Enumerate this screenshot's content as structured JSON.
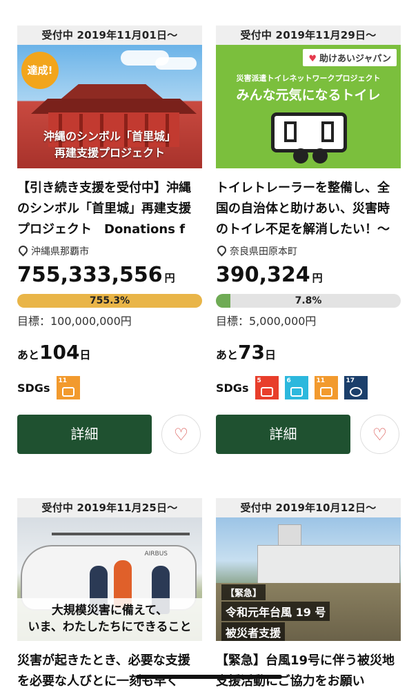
{
  "projects": [
    {
      "date": "受付中 2019年11月01日〜",
      "badge": "達成!",
      "banner_lines": [
        "沖縄のシンボル「首里城」",
        "再建支援プロジェクト"
      ],
      "title": "【引き続き支援を受付中】沖縄のシンボル「首里城」再建支援プロジェクト　Donations f",
      "location": "沖縄県那覇市",
      "amount": "755,333,556",
      "yen": "円",
      "progress_label": "755.3%",
      "progress_fraction": 1.0,
      "goal": "目標：100,000,000円",
      "remain_prefix": "あと",
      "remain_days": "104",
      "remain_suffix": "日",
      "sdgs_label": "SDGs",
      "sdgs": [
        {
          "num": "11",
          "color": "#f29a2e"
        }
      ],
      "detail_label": "詳細"
    },
    {
      "date": "受付中 2019年11月29日〜",
      "banner_tag": "助けあいジャパン",
      "banner_sub": "災害派遣トイレネットワークプロジェクト",
      "banner_main": "みんな元気になるトイレ",
      "title": "トイレトレーラーを整備し、全国の自治体と助けあい、災害時のトイレ不足を解消したい！〜",
      "location": "奈良県田原本町",
      "amount": "390,324",
      "yen": "円",
      "progress_label": "7.8%",
      "progress_fraction": 0.078,
      "goal": "目標：5,000,000円",
      "remain_prefix": "あと",
      "remain_days": "73",
      "remain_suffix": "日",
      "sdgs_label": "SDGs",
      "sdgs": [
        {
          "num": "5",
          "color": "#e83e2b"
        },
        {
          "num": "6",
          "color": "#2cb8dd"
        },
        {
          "num": "11",
          "color": "#f29a2e"
        },
        {
          "num": "17",
          "color": "#1b3f6b"
        }
      ],
      "detail_label": "詳細"
    },
    {
      "date": "受付中 2019年11月25日〜",
      "banner_lines": [
        "大規模災害に備えて、",
        "いま、わたしたちにできること"
      ],
      "heli_brand": "AIRBUS",
      "title": "災害が起きたとき、必要な支援を必要な人びとに一刻も早く"
    },
    {
      "date": "受付中 2019年10月12日〜",
      "banner_lines": [
        "【緊急】",
        "令和元年台風 19 号",
        "被災者支援"
      ],
      "title": "【緊急】台風19号に伴う被災地支援活動にご協力をお願い"
    }
  ],
  "colors": {
    "detail_button": "#1f5130",
    "progress_over": "#e9b548",
    "progress_normal": "#6fab55",
    "heart": "#d9534f"
  },
  "icons": {
    "location": "map-pin-icon",
    "favorite": "heart-outline-icon"
  }
}
